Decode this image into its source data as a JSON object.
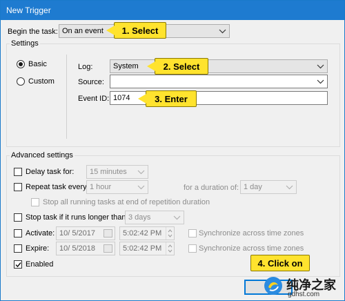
{
  "window": {
    "title": "New Trigger"
  },
  "begin": {
    "label": "Begin the task:",
    "value": "On an event",
    "callout": "1. Select"
  },
  "settings": {
    "group_label": "Settings",
    "radios": [
      {
        "label": "Basic",
        "checked": true
      },
      {
        "label": "Custom",
        "checked": false
      }
    ],
    "log": {
      "label": "Log:",
      "value": "System",
      "callout": "2. Select"
    },
    "source": {
      "label": "Source:",
      "value": ""
    },
    "event_id": {
      "label": "Event ID:",
      "value": "1074",
      "callout": "3. Enter"
    }
  },
  "advanced": {
    "group_label": "Advanced settings",
    "delay": {
      "label": "Delay task for:",
      "value": "15 minutes",
      "checked": false
    },
    "repeat": {
      "label": "Repeat task every:",
      "value": "1 hour",
      "checked": false,
      "duration_label": "for a duration of:",
      "duration_value": "1 day"
    },
    "stop_all_label": "Stop all running tasks at end of repetition duration",
    "stop_longer": {
      "label": "Stop task if it runs longer than:",
      "value": "3 days",
      "checked": false
    },
    "activate": {
      "label": "Activate:",
      "date": "10/ 5/2017",
      "time": "5:02:42 PM",
      "sync_label": "Synchronize across time zones",
      "checked": false
    },
    "expire": {
      "label": "Expire:",
      "date": "10/ 5/2018",
      "time": "5:02:42 PM",
      "sync_label": "Synchronize across time zones",
      "checked": false
    },
    "enabled": {
      "label": "Enabled",
      "checked": true
    }
  },
  "callout_4": "4. Click on",
  "watermark": {
    "text": "纯净之家",
    "url": "gdhst.com"
  },
  "colors": {
    "titlebar": "#1e7bd0",
    "callout": "#ffe32e",
    "dialog_bg": "#f0f0f0"
  }
}
